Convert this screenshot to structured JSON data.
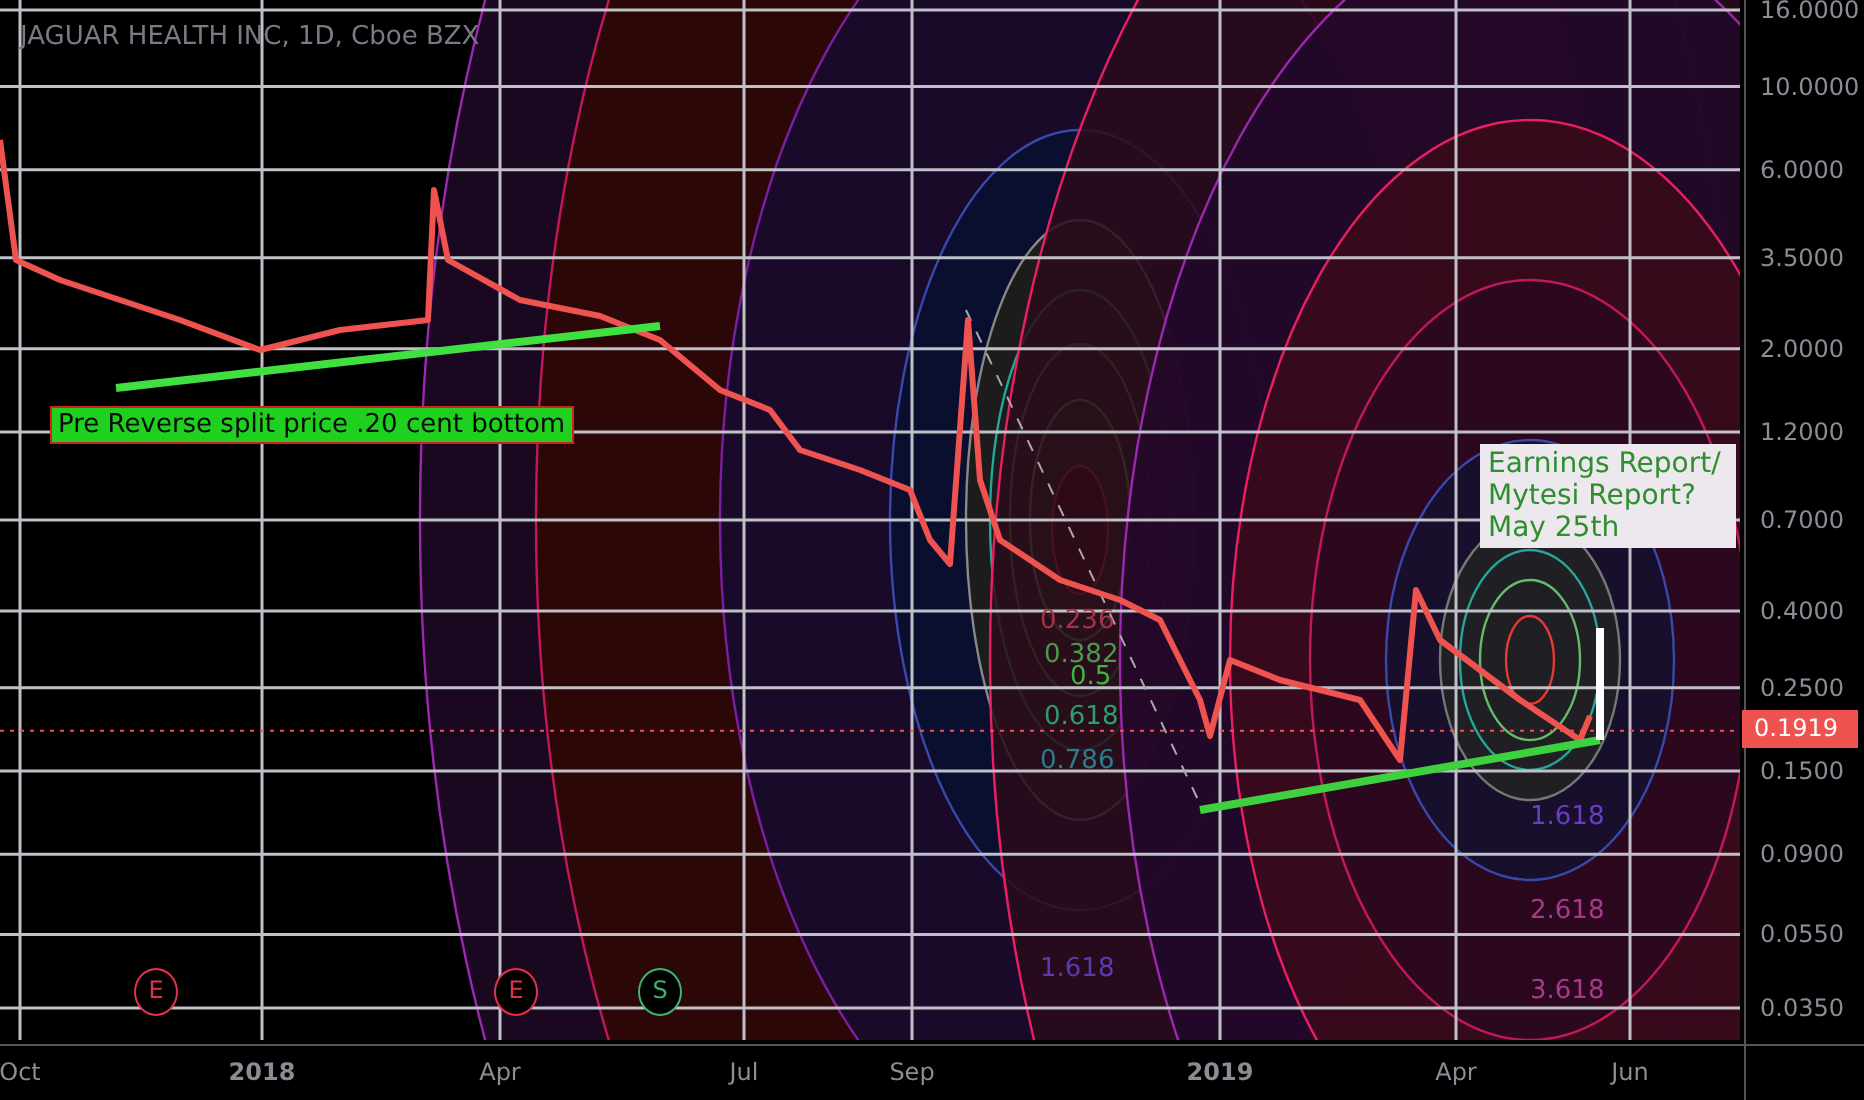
{
  "chart": {
    "title": "JAGUAR HEALTH INC, 1D, Cboe BZX",
    "price_axis": [
      "16.0000",
      "10.0000",
      "6.0000",
      "3.5000",
      "2.0000",
      "1.2000",
      "0.7000",
      "0.4000",
      "0.2500",
      "0.1500",
      "0.0900",
      "0.0550",
      "0.0350"
    ],
    "last_price": "0.1919",
    "time_axis": [
      {
        "label": "Oct",
        "bold": false
      },
      {
        "label": "2018",
        "bold": true
      },
      {
        "label": "Apr",
        "bold": false
      },
      {
        "label": "Jul",
        "bold": false
      },
      {
        "label": "Sep",
        "bold": false
      },
      {
        "label": "2019",
        "bold": true
      },
      {
        "label": "Apr",
        "bold": false
      },
      {
        "label": "Jun",
        "bold": false
      }
    ],
    "fib_labels": [
      {
        "text": "0.236",
        "color": "#a8324a"
      },
      {
        "text": "0.382",
        "color": "#4a9a4a"
      },
      {
        "text": "0.5",
        "color": "#3cb83c"
      },
      {
        "text": "0.618",
        "color": "#2e9e6e"
      },
      {
        "text": "0.786",
        "color": "#2a7d8c"
      },
      {
        "text": "1.618",
        "color": "#5a3cb0"
      },
      {
        "text": "1.618",
        "color": "#6a3cc0"
      },
      {
        "text": "2.618",
        "color": "#a83a8a"
      },
      {
        "text": "3.618",
        "color": "#a83a8a"
      }
    ],
    "annotations": [
      {
        "kind": "label",
        "lines": [
          "Pre Reverse split price .20 cent bottom"
        ]
      },
      {
        "kind": "callout",
        "lines": [
          "Earnings Report/",
          "Mytesi Report?",
          "May 25th"
        ]
      }
    ],
    "event_markers": [
      {
        "label": "E",
        "kind": "earnings"
      },
      {
        "label": "E",
        "kind": "earnings"
      },
      {
        "label": "S",
        "kind": "split"
      }
    ]
  }
}
